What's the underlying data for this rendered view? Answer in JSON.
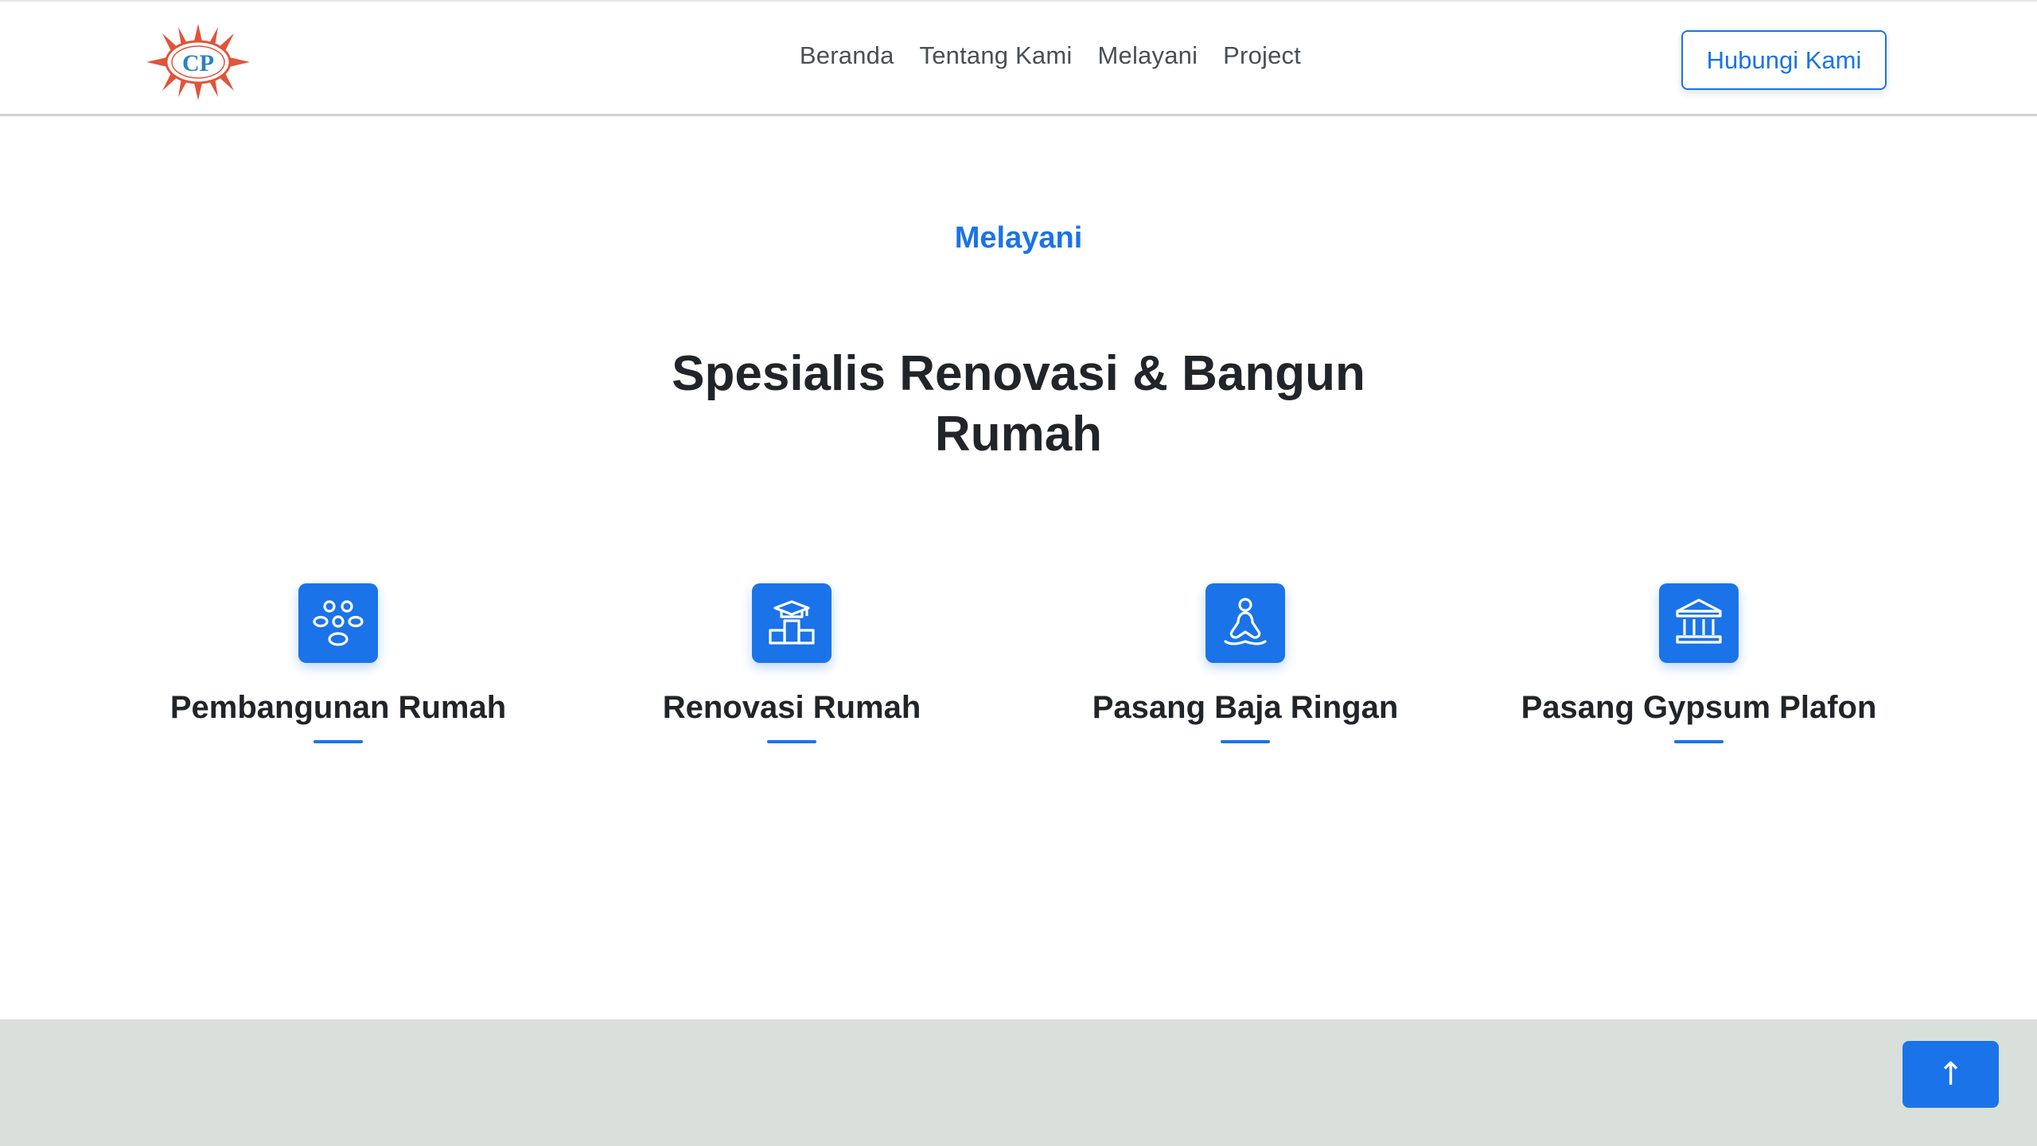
{
  "header": {
    "logo_text": "CP",
    "nav": [
      {
        "label": "Beranda"
      },
      {
        "label": "Tentang Kami"
      },
      {
        "label": "Melayani"
      },
      {
        "label": "Project"
      }
    ],
    "contact_button": "Hubungi Kami"
  },
  "section": {
    "label": "Melayani",
    "title": "Spesialis Renovasi & Bangun Rumah"
  },
  "services": [
    {
      "title": "Pembangunan Rumah",
      "icon": "people-group-icon"
    },
    {
      "title": "Renovasi Rumah",
      "icon": "graduation-podium-icon"
    },
    {
      "title": "Pasang Baja Ringan",
      "icon": "meditation-person-icon"
    },
    {
      "title": "Pasang Gypsum Plafon",
      "icon": "bank-building-icon"
    }
  ],
  "back_to_top": "↑",
  "colors": {
    "accent": "#1a73e8",
    "text": "#212529",
    "footer_band": "#d9dfdb"
  }
}
